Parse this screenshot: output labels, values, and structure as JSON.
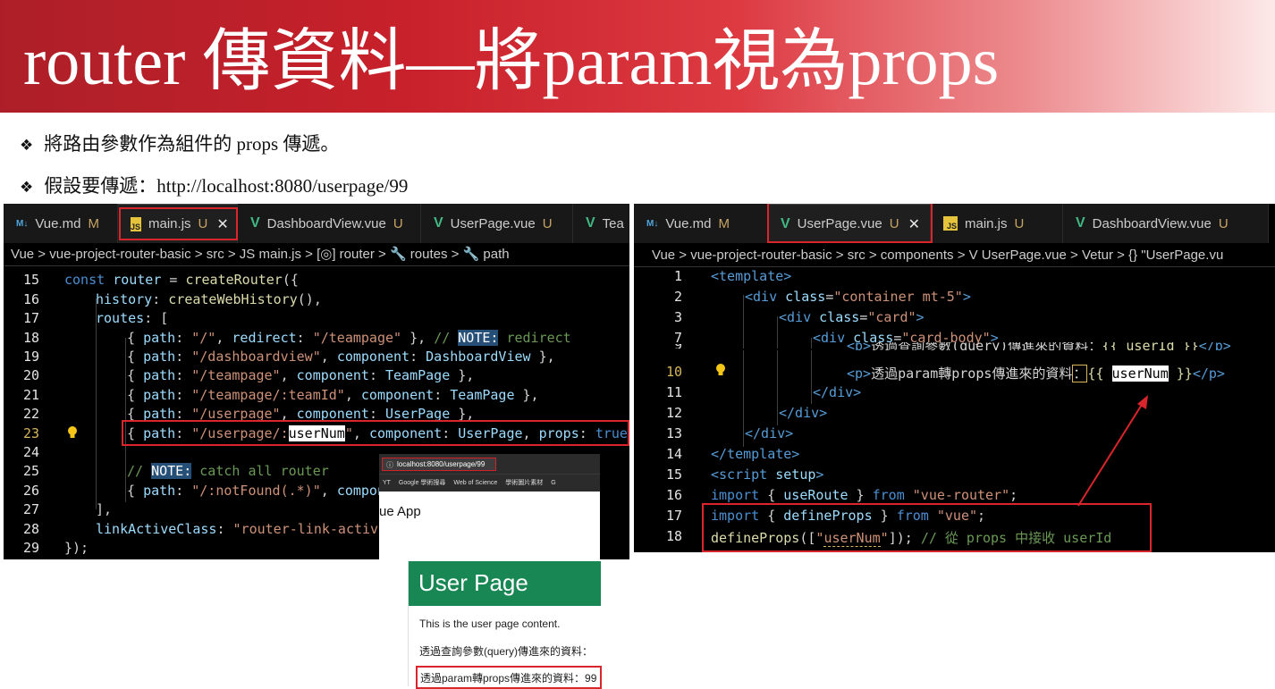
{
  "slide": {
    "title": "router 傳資料—將param視為props",
    "bullets": [
      {
        "marker": "❖",
        "text": "將路由參數作為組件的 props 傳遞。"
      },
      {
        "marker": "❖",
        "text": "假設要傳遞：http://localhost:8080/userpage/99"
      }
    ]
  },
  "left_editor": {
    "tabs": [
      {
        "icon": "M↓",
        "label": "Vue.md",
        "status": "M"
      },
      {
        "icon": "JS",
        "label": "main.js",
        "status": "U",
        "close": "✕"
      },
      {
        "icon": "V",
        "label": "DashboardView.vue",
        "status": "U"
      },
      {
        "icon": "V",
        "label": "UserPage.vue",
        "status": "U"
      },
      {
        "icon": "V",
        "label": "Tea"
      }
    ],
    "breadcrumb": "Vue > vue-project-router-basic > src > JS main.js > [◎] router > 🔧 routes > 🔧 path",
    "lines": [
      {
        "n": "15",
        "code": "const router = createRouter({"
      },
      {
        "n": "16",
        "code": "history: createWebHistory(),"
      },
      {
        "n": "17",
        "code": "routes: ["
      },
      {
        "n": "18",
        "code": "{ path: \"/\", redirect: \"/teampage\" }, // NOTE: redirect"
      },
      {
        "n": "19",
        "code": "{ path: \"/dashboardview\", component: DashboardView },"
      },
      {
        "n": "20",
        "code": "{ path: \"/teampage\", component: TeamPage },"
      },
      {
        "n": "21",
        "code": "{ path: \"/teampage/:teamId\", component: TeamPage },"
      },
      {
        "n": "22",
        "code": "{ path: \"/userpage\", component: UserPage },"
      },
      {
        "n": "23",
        "code": "{ path: \"/userpage/:userNum\", component: UserPage, props: true },"
      },
      {
        "n": "24",
        "code": ""
      },
      {
        "n": "25",
        "code": "// NOTE: catch all router"
      },
      {
        "n": "26",
        "code": "{ path: \"/:notFound(.*)\", compone"
      },
      {
        "n": "27",
        "code": "],"
      },
      {
        "n": "28",
        "code": "linkActiveClass: \"router-link-activat"
      },
      {
        "n": "29",
        "code": "});"
      }
    ]
  },
  "right_editor": {
    "tabs": [
      {
        "icon": "M↓",
        "label": "Vue.md",
        "status": "M"
      },
      {
        "icon": "V",
        "label": "UserPage.vue",
        "status": "U",
        "close": "✕"
      },
      {
        "icon": "JS",
        "label": "main.js",
        "status": "U"
      },
      {
        "icon": "V",
        "label": "DashboardView.vue",
        "status": "U"
      }
    ],
    "breadcrumb": "Vue > vue-project-router-basic > src > components > V UserPage.vue > Vetur > {} \"UserPage.vu",
    "lines": [
      {
        "n": "1",
        "code": "<template>"
      },
      {
        "n": "2",
        "code": "<div class=\"container mt-5\">"
      },
      {
        "n": "3",
        "code": "<div class=\"card\">"
      },
      {
        "n": "7",
        "code": "<div class=\"card-body\">"
      },
      {
        "n": "9",
        "code": "<p>透過查詢參數(query)傳進來的資料：{{ userId }}</p>"
      },
      {
        "n": "10",
        "code": "<p>透過param轉props傳進來的資料：{{ userNum }}</p>"
      },
      {
        "n": "11",
        "code": "</div>"
      },
      {
        "n": "12",
        "code": "</div>"
      },
      {
        "n": "13",
        "code": "</div>"
      },
      {
        "n": "14",
        "code": "</template>"
      },
      {
        "n": "15",
        "code": "<script setup>"
      },
      {
        "n": "16",
        "code": "import { useRoute } from \"vue-router\";"
      },
      {
        "n": "17",
        "code": "import { defineProps } from \"vue\";"
      },
      {
        "n": "18",
        "code": "defineProps([\"userNum\"]); // 從 props 中接收 userId"
      }
    ]
  },
  "browser": {
    "url": "localhost:8080/userpage/99",
    "bookmarks": [
      "YT",
      "Google 學術搜尋",
      "Web of Science",
      "學術圖片素材",
      "G"
    ],
    "app_title": "ue App"
  },
  "card": {
    "header": "User Page",
    "content": "This is the user page content.",
    "query_line": "透過查詢參數(query)傳進來的資料：",
    "props_line": "透過param轉props傳進來的資料：99"
  },
  "colors": {
    "title_red": "#c8212b",
    "highlight_red": "#d9252b",
    "card_green": "#198754"
  }
}
